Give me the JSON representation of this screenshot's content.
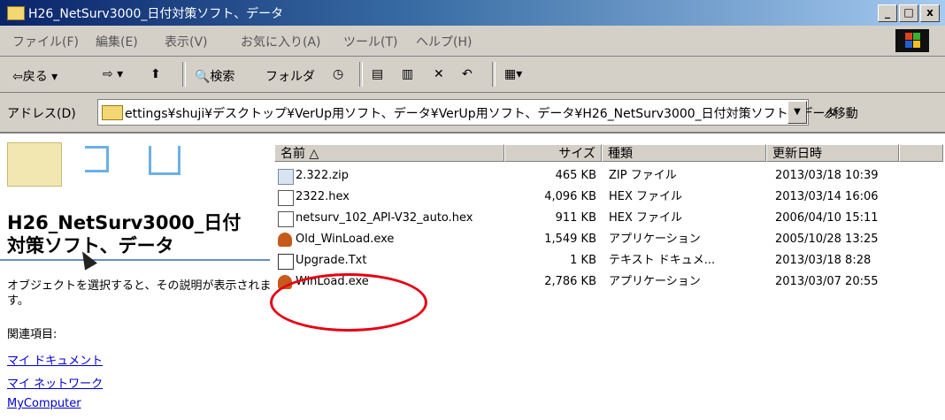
{
  "window": {
    "title": "H26_NetSurv3000_日付対策ソフト、データ",
    "controls": {
      "minimize": "_",
      "maximize": "□",
      "close": "x"
    }
  },
  "menu": [
    {
      "label": "ファイル(F)"
    },
    {
      "label": "編集(E)"
    },
    {
      "label": "表示(V)"
    },
    {
      "label": "お気に入り(A)"
    },
    {
      "label": "ツール(T)"
    },
    {
      "label": "ヘルプ(H)"
    }
  ],
  "toolbar": {
    "back": "⇦戻る ▾",
    "forward": "⇨ ▾",
    "up": "⬆",
    "search": "🔍検索",
    "folders": "フォルダ",
    "history": "◷",
    "move": "▤",
    "copy": "▥",
    "delete": "✕",
    "undo": "↶",
    "views": "▦▾"
  },
  "address": {
    "label": "アドレス(D)",
    "path": "ettings¥shuji¥デスクトップ¥VerUp用ソフト、データ¥VerUp用ソフト、データ¥H26_NetSurv3000_日付対策ソフト、データ",
    "go": "移動"
  },
  "left_pane": {
    "folder_title": "H26_NetSurv3000_日付\n対策ソフト、データ",
    "description": "オブジェクトを選択すると、その説明が表示されます。",
    "related_heading": "関連項目:",
    "links": [
      "マイ ドキュメント",
      "マイ ネットワーク",
      "MyComputer"
    ]
  },
  "columns": {
    "name": "名前 △",
    "size": "サイズ",
    "type": "種類",
    "modified": "更新日時"
  },
  "files": [
    {
      "name": "2.322.zip",
      "size": "465 KB",
      "type": "ZIP ファイル",
      "modified": "2013/03/18 10:39",
      "icon": "zip-icon"
    },
    {
      "name": "2322.hex",
      "size": "4,096 KB",
      "type": "HEX ファイル",
      "modified": "2013/03/14 16:06",
      "icon": "hex-file-icon"
    },
    {
      "name": "netsurv_102_API-V32_auto.hex",
      "size": "911 KB",
      "type": "HEX ファイル",
      "modified": "2006/04/10 15:11",
      "icon": "hex-file-icon"
    },
    {
      "name": "Old_WinLoad.exe",
      "size": "1,549 KB",
      "type": "アプリケーション",
      "modified": "2005/10/28 13:25",
      "icon": "application-icon"
    },
    {
      "name": "Upgrade.Txt",
      "size": "1 KB",
      "type": "テキスト ドキュメ...",
      "modified": "2013/03/18 8:28",
      "icon": "text-file-icon"
    },
    {
      "name": "WinLoad.exe",
      "size": "2,786 KB",
      "type": "アプリケーション",
      "modified": "2013/03/07 20:55",
      "icon": "application-icon"
    }
  ],
  "colors": {
    "highlight_ellipse": "#e60012",
    "link": "#0000cc",
    "chrome": "#d4d0c8"
  }
}
